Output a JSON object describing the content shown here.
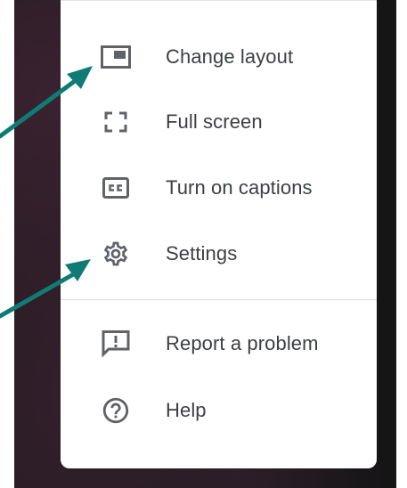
{
  "menu": {
    "items": [
      {
        "label": "Change layout",
        "icon": "change-layout-icon"
      },
      {
        "label": "Full screen",
        "icon": "fullscreen-icon"
      },
      {
        "label": "Turn on captions",
        "icon": "captions-icon"
      },
      {
        "label": "Settings",
        "icon": "gear-icon"
      },
      {
        "label": "Report a problem",
        "icon": "report-problem-icon"
      },
      {
        "label": "Help",
        "icon": "help-icon"
      }
    ]
  },
  "colors": {
    "menu_text": "#3c4043",
    "icon": "#5f6368",
    "annotation_arrow": "#0e7c74",
    "video_background": "#1e1a1d",
    "divider": "#dadce0"
  }
}
